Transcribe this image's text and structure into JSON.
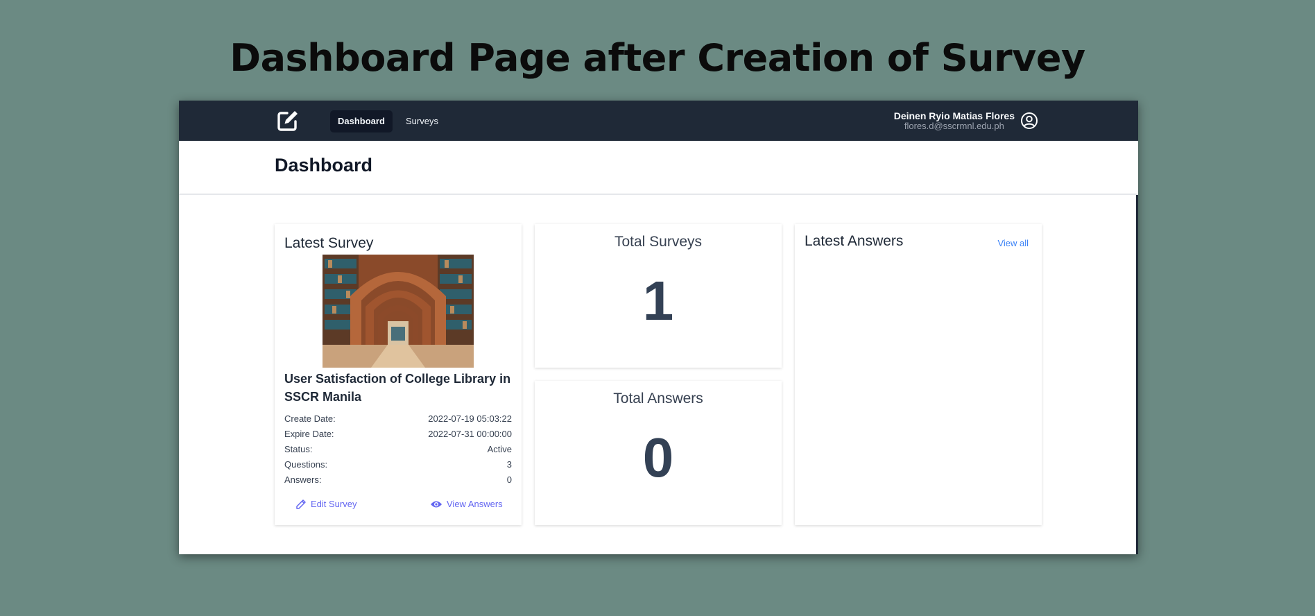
{
  "slide": {
    "title": "Dashboard Page after Creation of Survey"
  },
  "navbar": {
    "items": [
      {
        "label": "Dashboard",
        "active": true
      },
      {
        "label": "Surveys",
        "active": false
      }
    ],
    "user": {
      "name": "Deinen Ryio Matias Flores",
      "email": "flores.d@sscrmnl.edu.ph"
    }
  },
  "header": {
    "title": "Dashboard"
  },
  "latest_survey": {
    "heading": "Latest Survey",
    "title": "User Satisfaction of College Library in SSCR Manila",
    "meta": [
      {
        "label": "Create Date:",
        "value": "2022-07-19 05:03:22"
      },
      {
        "label": "Expire Date:",
        "value": "2022-07-31 00:00:00"
      },
      {
        "label": "Status:",
        "value": "Active"
      },
      {
        "label": "Questions:",
        "value": "3"
      },
      {
        "label": "Answers:",
        "value": "0"
      }
    ],
    "edit_label": "Edit Survey",
    "view_label": "View Answers"
  },
  "stats": {
    "total_surveys": {
      "label": "Total Surveys",
      "value": "1"
    },
    "total_answers": {
      "label": "Total Answers",
      "value": "0"
    }
  },
  "latest_answers": {
    "heading": "Latest Answers",
    "view_all_label": "View all"
  },
  "colors": {
    "background": "#6b8a83",
    "navbar": "#1f2937",
    "accent_indigo": "#6366f1",
    "link_blue": "#3b82f6"
  }
}
